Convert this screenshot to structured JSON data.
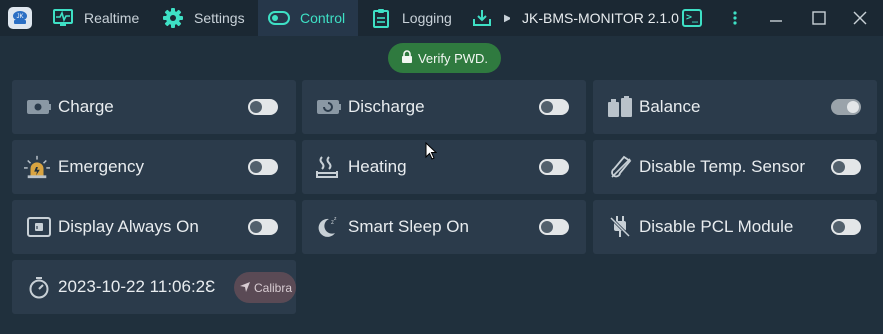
{
  "app": {
    "title": "JK-BMS-MONITOR 2.1.0",
    "accent_color": "#3ee0c5",
    "logo_text": "JK"
  },
  "tabs": [
    {
      "label": "Realtime",
      "icon": "monitor-pulse-icon"
    },
    {
      "label": "Settings",
      "icon": "gear-icon"
    },
    {
      "label": "Control",
      "icon": "toggle-icon",
      "active": true
    },
    {
      "label": "Logging",
      "icon": "clipboard-icon"
    },
    {
      "label": "",
      "icon": "download-icon"
    }
  ],
  "window_controls": [
    "terminal-icon",
    "more-vertical-icon",
    "minimize-icon",
    "maximize-icon",
    "close-icon"
  ],
  "verify": {
    "label": "Verify PWD.",
    "icon": "lock-icon",
    "color": "#2f7a3f"
  },
  "controls": [
    {
      "label": "Charge",
      "icon": "battery-charge-icon",
      "state": "off"
    },
    {
      "label": "Discharge",
      "icon": "battery-discharge-icon",
      "state": "off"
    },
    {
      "label": "Balance",
      "icon": "battery-balance-icon",
      "state": "on"
    },
    {
      "label": "Emergency",
      "icon": "alarm-light-icon",
      "state": "off"
    },
    {
      "label": "Heating",
      "icon": "heating-icon",
      "state": "off"
    },
    {
      "label": "Disable Temp. Sensor",
      "icon": "temperature-sensor-off-icon",
      "state": "off"
    },
    {
      "label": "Display Always On",
      "icon": "display-icon",
      "state": "off"
    },
    {
      "label": "Smart Sleep On",
      "icon": "moon-sleep-icon",
      "state": "off"
    },
    {
      "label": "Disable PCL Module",
      "icon": "plug-off-icon",
      "state": "off"
    }
  ],
  "clock": {
    "datetime": "2023-10-22 11:06:2Ɛ",
    "icon": "timer-icon",
    "calibrate_label": "Calibra",
    "calibrate_icon": "send-icon"
  }
}
